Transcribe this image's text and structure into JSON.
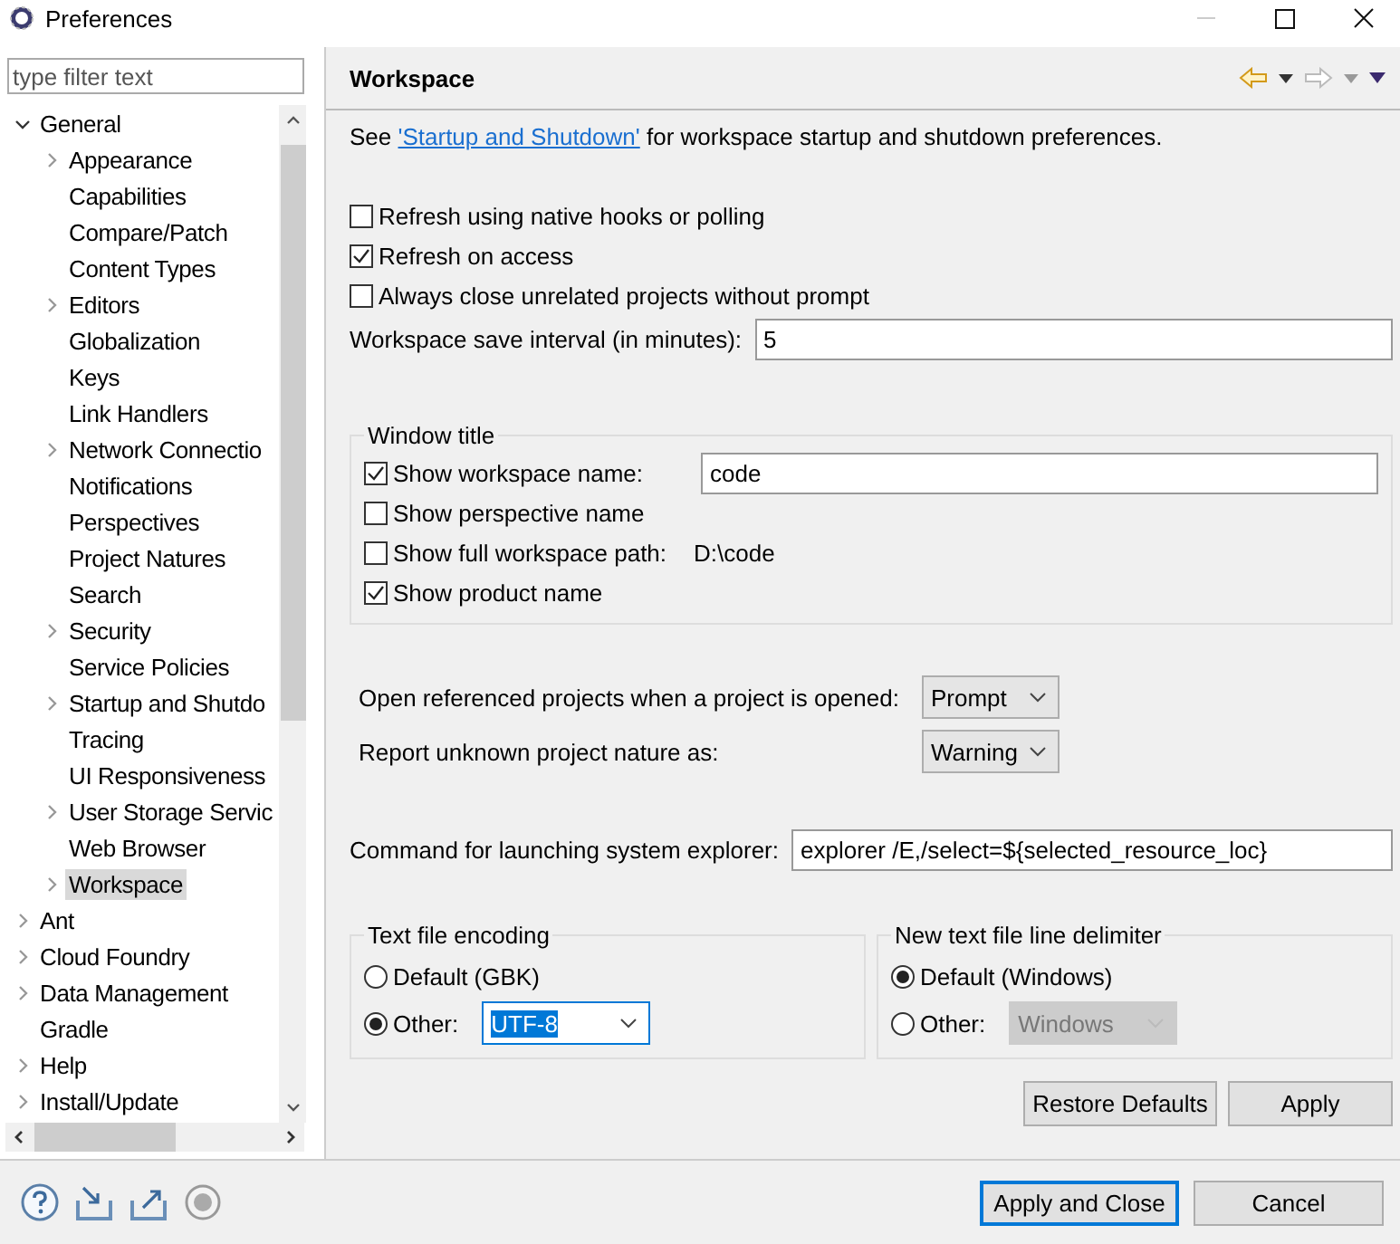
{
  "window": {
    "title": "Preferences"
  },
  "filter": {
    "placeholder": "type filter text"
  },
  "tree": [
    {
      "label": "General",
      "expanded": true,
      "selected": false,
      "children": [
        {
          "label": "Appearance",
          "expanded": false,
          "selected": false
        },
        {
          "label": "Capabilities",
          "selected": false
        },
        {
          "label": "Compare/Patch",
          "selected": false
        },
        {
          "label": "Content Types",
          "selected": false
        },
        {
          "label": "Editors",
          "expanded": false,
          "selected": false
        },
        {
          "label": "Globalization",
          "selected": false
        },
        {
          "label": "Keys",
          "selected": false
        },
        {
          "label": "Link Handlers",
          "selected": false
        },
        {
          "label": "Network Connectio",
          "expanded": false,
          "selected": false
        },
        {
          "label": "Notifications",
          "selected": false
        },
        {
          "label": "Perspectives",
          "selected": false
        },
        {
          "label": "Project Natures",
          "selected": false
        },
        {
          "label": "Search",
          "selected": false
        },
        {
          "label": "Security",
          "expanded": false,
          "selected": false
        },
        {
          "label": "Service Policies",
          "selected": false
        },
        {
          "label": "Startup and Shutdo",
          "expanded": false,
          "selected": false
        },
        {
          "label": "Tracing",
          "selected": false
        },
        {
          "label": "UI Responsiveness",
          "selected": false
        },
        {
          "label": "User Storage Servic",
          "expanded": false,
          "selected": false
        },
        {
          "label": "Web Browser",
          "selected": false
        },
        {
          "label": "Workspace",
          "expanded": false,
          "selected": true
        }
      ]
    },
    {
      "label": "Ant",
      "expanded": false,
      "selected": false
    },
    {
      "label": "Cloud Foundry",
      "expanded": false,
      "selected": false
    },
    {
      "label": "Data Management",
      "expanded": false,
      "selected": false
    },
    {
      "label": "Gradle",
      "selected": false
    },
    {
      "label": "Help",
      "expanded": false,
      "selected": false
    },
    {
      "label": "Install/Update",
      "expanded": false,
      "selected": false
    }
  ],
  "page": {
    "title": "Workspace",
    "intro": {
      "before": "See",
      "link": "'Startup and Shutdown'",
      "after": "for workspace startup and shutdown preferences."
    },
    "checkboxes": [
      {
        "label": "Refresh using native hooks or polling",
        "checked": false
      },
      {
        "label": "Refresh on access",
        "checked": true
      },
      {
        "label": "Always close unrelated projects without prompt",
        "checked": false
      }
    ],
    "save_interval": {
      "label": "Workspace save interval (in minutes):",
      "value": "5"
    },
    "window_title": {
      "title": "Window title",
      "options": [
        {
          "kind": "field",
          "label": "Show workspace name:",
          "checked": true,
          "value": "code"
        },
        {
          "kind": "plain",
          "label": "Show perspective name",
          "checked": false
        },
        {
          "kind": "text",
          "label": "Show full workspace path:",
          "checked": false,
          "value": "D:\\code"
        },
        {
          "kind": "plain",
          "label": "Show product name",
          "checked": true
        }
      ]
    },
    "selects": [
      {
        "label": "Open referenced projects when a project is opened:",
        "value": "Prompt"
      },
      {
        "label": "Report unknown project nature as:",
        "value": "Warning"
      }
    ],
    "command": {
      "label": "Command for launching system explorer:",
      "value": "explorer /E,/select=${selected_resource_loc}"
    },
    "groups": [
      {
        "title": "Text file encoding",
        "options": [
          {
            "kind": "plain",
            "label": "Default (GBK)",
            "selected": false
          },
          {
            "kind": "select",
            "label": "Other:",
            "selected": true,
            "value": "UTF-8",
            "disabled": false
          }
        ]
      },
      {
        "title": "New text file line delimiter",
        "options": [
          {
            "kind": "plain",
            "label": "Default (Windows)",
            "selected": true
          },
          {
            "kind": "select",
            "label": "Other:",
            "selected": false,
            "value": "Windows",
            "disabled": true
          }
        ]
      }
    ],
    "buttons": [
      "Restore Defaults",
      "Apply"
    ]
  },
  "footer": {
    "buttons": [
      {
        "label": "Apply and Close",
        "default": true
      },
      {
        "label": "Cancel",
        "default": false
      }
    ]
  }
}
